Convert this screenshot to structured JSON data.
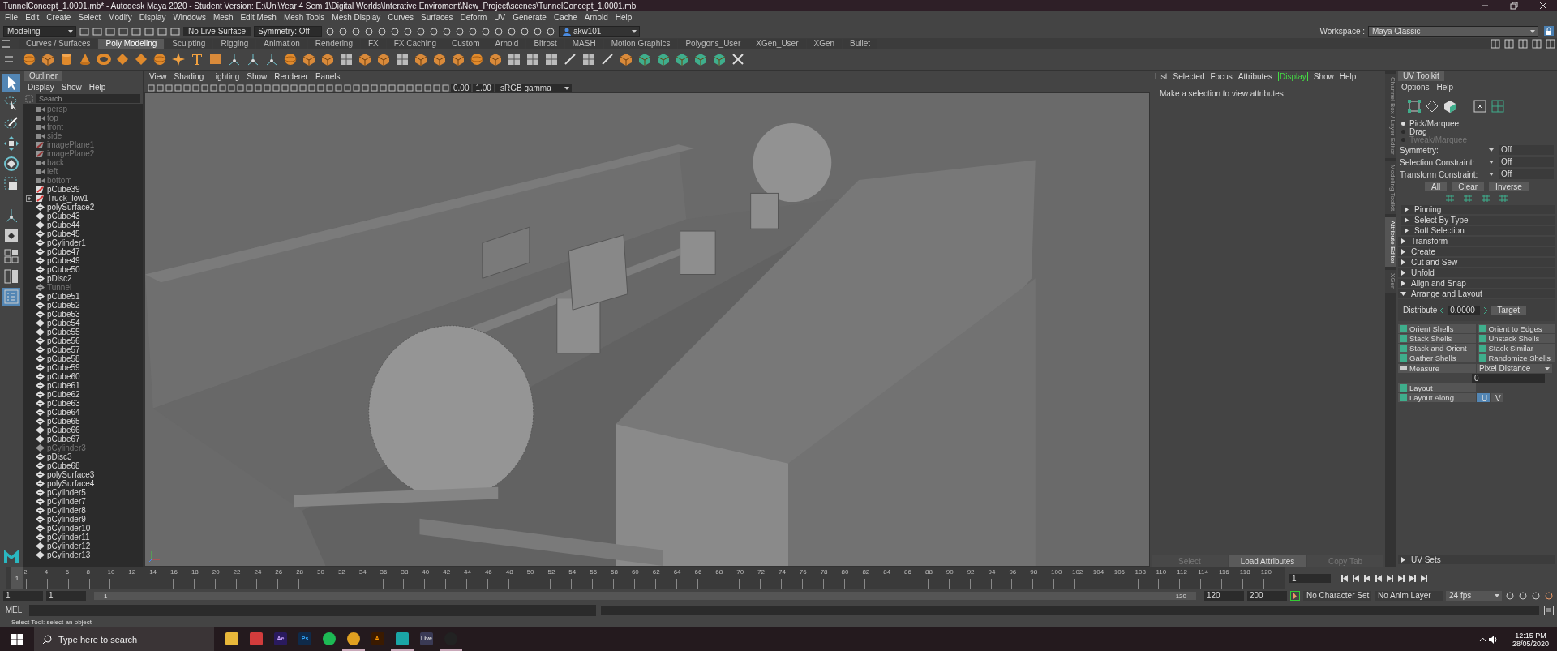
{
  "window": {
    "title": "TunnelConcept_1.0001.mb* - Autodesk Maya 2020 - Student Version: E:\\Uni\\Year 4 Sem 1\\Digital Worlds\\Interative Enviroment\\New_Project\\scenes\\TunnelConcept_1.0001.mb"
  },
  "menu": [
    "File",
    "Edit",
    "Create",
    "Select",
    "Modify",
    "Display",
    "Windows",
    "Mesh",
    "Edit Mesh",
    "Mesh Tools",
    "Mesh Display",
    "Curves",
    "Surfaces",
    "Deform",
    "UV",
    "Generate",
    "Cache",
    "Arnold",
    "Help"
  ],
  "status_line": {
    "menu_set": "Modeling",
    "live_surface": "No Live Surface",
    "symmetry": "Symmetry: Off",
    "user": "akw101",
    "workspace_label": "Workspace :",
    "workspace": "Maya Classic"
  },
  "shelf_tabs": [
    {
      "label": "Curves / Surfaces",
      "selected": false
    },
    {
      "label": "Poly Modeling",
      "selected": true
    },
    {
      "label": "Sculpting",
      "selected": false
    },
    {
      "label": "Rigging",
      "selected": false
    },
    {
      "label": "Animation",
      "selected": false
    },
    {
      "label": "Rendering",
      "selected": false
    },
    {
      "label": "FX",
      "selected": false
    },
    {
      "label": "FX Caching",
      "selected": false
    },
    {
      "label": "Custom",
      "selected": false
    },
    {
      "label": "Arnold",
      "selected": false
    },
    {
      "label": "Bifrost",
      "selected": false
    },
    {
      "label": "MASH",
      "selected": false
    },
    {
      "label": "Motion Graphics",
      "selected": false
    },
    {
      "label": "Polygons_User",
      "selected": false
    },
    {
      "label": "XGen_User",
      "selected": false
    },
    {
      "label": "XGen",
      "selected": false
    },
    {
      "label": "Bullet",
      "selected": false
    }
  ],
  "outliner": {
    "title": "Outliner",
    "menu": [
      "Display",
      "Show",
      "Help"
    ],
    "search_placeholder": "Search...",
    "items": [
      {
        "name": "persp",
        "kind": "camera",
        "hidden": true
      },
      {
        "name": "top",
        "kind": "camera",
        "hidden": true
      },
      {
        "name": "front",
        "kind": "camera",
        "hidden": true
      },
      {
        "name": "side",
        "kind": "camera",
        "hidden": true
      },
      {
        "name": "imagePlane1",
        "kind": "imageplane",
        "hidden": true
      },
      {
        "name": "imagePlane2",
        "kind": "imageplane",
        "hidden": true
      },
      {
        "name": "back",
        "kind": "camera",
        "hidden": true
      },
      {
        "name": "left",
        "kind": "camera",
        "hidden": true
      },
      {
        "name": "bottom",
        "kind": "camera",
        "hidden": true
      },
      {
        "name": "pCube39",
        "kind": "imageplane",
        "hidden": false
      },
      {
        "name": "Truck_low1",
        "kind": "imageplane",
        "hidden": false,
        "expanded": false
      },
      {
        "name": "polySurface2",
        "kind": "mesh",
        "hidden": false
      },
      {
        "name": "pCube43",
        "kind": "mesh",
        "hidden": false
      },
      {
        "name": "pCube44",
        "kind": "mesh",
        "hidden": false
      },
      {
        "name": "pCube45",
        "kind": "mesh",
        "hidden": false
      },
      {
        "name": "pCylinder1",
        "kind": "mesh",
        "hidden": false
      },
      {
        "name": "pCube47",
        "kind": "mesh",
        "hidden": false
      },
      {
        "name": "pCube49",
        "kind": "mesh",
        "hidden": false
      },
      {
        "name": "pCube50",
        "kind": "mesh",
        "hidden": false
      },
      {
        "name": "pDisc2",
        "kind": "mesh",
        "hidden": false
      },
      {
        "name": "Tunnel",
        "kind": "mesh",
        "hidden": true
      },
      {
        "name": "pCube51",
        "kind": "mesh",
        "hidden": false
      },
      {
        "name": "pCube52",
        "kind": "mesh",
        "hidden": false
      },
      {
        "name": "pCube53",
        "kind": "mesh",
        "hidden": false
      },
      {
        "name": "pCube54",
        "kind": "mesh",
        "hidden": false
      },
      {
        "name": "pCube55",
        "kind": "mesh",
        "hidden": false
      },
      {
        "name": "pCube56",
        "kind": "mesh",
        "hidden": false
      },
      {
        "name": "pCube57",
        "kind": "mesh",
        "hidden": false
      },
      {
        "name": "pCube58",
        "kind": "mesh",
        "hidden": false
      },
      {
        "name": "pCube59",
        "kind": "mesh",
        "hidden": false
      },
      {
        "name": "pCube60",
        "kind": "mesh",
        "hidden": false
      },
      {
        "name": "pCube61",
        "kind": "mesh",
        "hidden": false
      },
      {
        "name": "pCube62",
        "kind": "mesh",
        "hidden": false
      },
      {
        "name": "pCube63",
        "kind": "mesh",
        "hidden": false
      },
      {
        "name": "pCube64",
        "kind": "mesh",
        "hidden": false
      },
      {
        "name": "pCube65",
        "kind": "mesh",
        "hidden": false
      },
      {
        "name": "pCube66",
        "kind": "mesh",
        "hidden": false
      },
      {
        "name": "pCube67",
        "kind": "mesh",
        "hidden": false
      },
      {
        "name": "pCylinder3",
        "kind": "mesh",
        "hidden": true
      },
      {
        "name": "pDisc3",
        "kind": "mesh",
        "hidden": false
      },
      {
        "name": "pCube68",
        "kind": "mesh",
        "hidden": false
      },
      {
        "name": "polySurface3",
        "kind": "mesh",
        "hidden": false
      },
      {
        "name": "polySurface4",
        "kind": "mesh",
        "hidden": false
      },
      {
        "name": "pCylinder5",
        "kind": "mesh",
        "hidden": false
      },
      {
        "name": "pCylinder7",
        "kind": "mesh",
        "hidden": false
      },
      {
        "name": "pCylinder8",
        "kind": "mesh",
        "hidden": false
      },
      {
        "name": "pCylinder9",
        "kind": "mesh",
        "hidden": false
      },
      {
        "name": "pCylinder10",
        "kind": "mesh",
        "hidden": false
      },
      {
        "name": "pCylinder11",
        "kind": "mesh",
        "hidden": false
      },
      {
        "name": "pCylinder12",
        "kind": "mesh",
        "hidden": false
      },
      {
        "name": "pCylinder13",
        "kind": "mesh",
        "hidden": false
      }
    ]
  },
  "viewport": {
    "menu": [
      "View",
      "Shading",
      "Lighting",
      "Show",
      "Renderer",
      "Panels"
    ],
    "exposure": "0.00",
    "gamma": "1.00",
    "color_space": "sRGB gamma"
  },
  "attribute_editor": {
    "menu": [
      {
        "label": "List",
        "selected": false
      },
      {
        "label": "Selected",
        "selected": false
      },
      {
        "label": "Focus",
        "selected": false
      },
      {
        "label": "Attributes",
        "selected": false
      },
      {
        "label": "Display",
        "selected": true
      },
      {
        "label": "Show",
        "selected": false
      },
      {
        "label": "Help",
        "selected": false
      }
    ],
    "message": "Make a selection to view attributes",
    "buttons": [
      {
        "label": "Select",
        "disabled": true
      },
      {
        "label": "Load Attributes",
        "disabled": false
      },
      {
        "label": "Copy Tab",
        "disabled": true
      }
    ]
  },
  "side_tabs": [
    {
      "label": "Channel Box / Layer Editor",
      "selected": false
    },
    {
      "label": "Modeling Toolkit",
      "selected": false
    },
    {
      "label": "Attribute Editor",
      "selected": true
    },
    {
      "label": "XGen",
      "selected": false
    }
  ],
  "uv_toolkit": {
    "title": "UV Toolkit",
    "menu": [
      "Options",
      "Help"
    ],
    "modes": [
      {
        "label": "Pick/Marquee",
        "selected": true,
        "disabled": false
      },
      {
        "label": "Drag",
        "selected": false,
        "disabled": false
      },
      {
        "label": "Tweak/Marquee",
        "selected": false,
        "disabled": true
      }
    ],
    "options": [
      {
        "label": "Symmetry:",
        "value": "Off"
      },
      {
        "label": "Selection Constraint:",
        "value": "Off"
      },
      {
        "label": "Transform Constraint:",
        "value": "Off"
      }
    ],
    "select_buttons": [
      "All",
      "Clear",
      "Inverse"
    ],
    "sections": [
      {
        "label": "Pinning",
        "expanded": false
      },
      {
        "label": "Select By Type",
        "expanded": false
      },
      {
        "label": "Soft Selection",
        "expanded": false
      },
      {
        "label": "Transform",
        "expanded": false
      },
      {
        "label": "Create",
        "expanded": false
      },
      {
        "label": "Cut and Sew",
        "expanded": false
      },
      {
        "label": "Unfold",
        "expanded": false
      },
      {
        "label": "Align and Snap",
        "expanded": false
      },
      {
        "label": "Arrange and Layout",
        "expanded": true
      }
    ],
    "distribute_label": "Distribute",
    "distribute_value": "0.0000",
    "target": "Target",
    "tools": [
      "Orient Shells",
      "Orient to Edges",
      "Stack Shells",
      "Unstack Shells",
      "Stack and Orient",
      "Stack Similar",
      "Gather Shells",
      "Randomize Shells"
    ],
    "measure": "Measure",
    "measure_unit": "Pixel Distance",
    "measure_value": "0",
    "layout": "Layout",
    "layout_along": "Layout Along",
    "axes": [
      {
        "label": "U",
        "selected": true
      },
      {
        "label": "V",
        "selected": false
      }
    ],
    "uv_sets": {
      "label": "UV Sets",
      "expanded": false
    }
  },
  "timeline": {
    "current_frame": "1",
    "level": 0,
    "labels": [
      "2",
      "4",
      "6",
      "8",
      "10",
      "12",
      "14",
      "16",
      "18",
      "20",
      "22",
      "24",
      "26",
      "28",
      "30",
      "32",
      "34",
      "36",
      "38",
      "40",
      "42",
      "44",
      "46",
      "48",
      "50",
      "52",
      "54",
      "56",
      "58",
      "60",
      "62",
      "64",
      "66",
      "68",
      "70",
      "72",
      "74",
      "76",
      "78",
      "80",
      "82",
      "84",
      "86",
      "88",
      "90",
      "92",
      "94",
      "96",
      "98",
      "100",
      "102",
      "104",
      "106",
      "108",
      "110",
      "112",
      "114",
      "116",
      "118",
      "120"
    ],
    "frame_field": "1"
  },
  "range": {
    "start": "1",
    "playback_start": "1",
    "slider_start": "1",
    "slider_end": "120",
    "level": 1,
    "playback_end": "120",
    "end": "200",
    "character_set": "No Character Set",
    "anim_layer": "No Anim Layer",
    "fps": "24 fps"
  },
  "command_line": {
    "label": "MEL"
  },
  "help_line": "Select Tool: select an object",
  "taskbar": {
    "search_placeholder": "Type here to search",
    "apps": [
      {
        "kind": "folder",
        "running": false
      },
      {
        "kind": "red",
        "running": false
      },
      {
        "kind": "purple",
        "label": "Ae",
        "running": false
      },
      {
        "kind": "blue",
        "label": "Ps",
        "running": false
      },
      {
        "kind": "spotify",
        "running": false
      },
      {
        "kind": "chrome",
        "running": true
      },
      {
        "kind": "orange",
        "label": "Ai",
        "running": false
      },
      {
        "kind": "maya",
        "running": true
      },
      {
        "kind": "gray",
        "label": "Live",
        "running": false
      },
      {
        "kind": "unreal",
        "running": true
      }
    ],
    "time": "12:15 PM",
    "date": "28/05/2020"
  }
}
